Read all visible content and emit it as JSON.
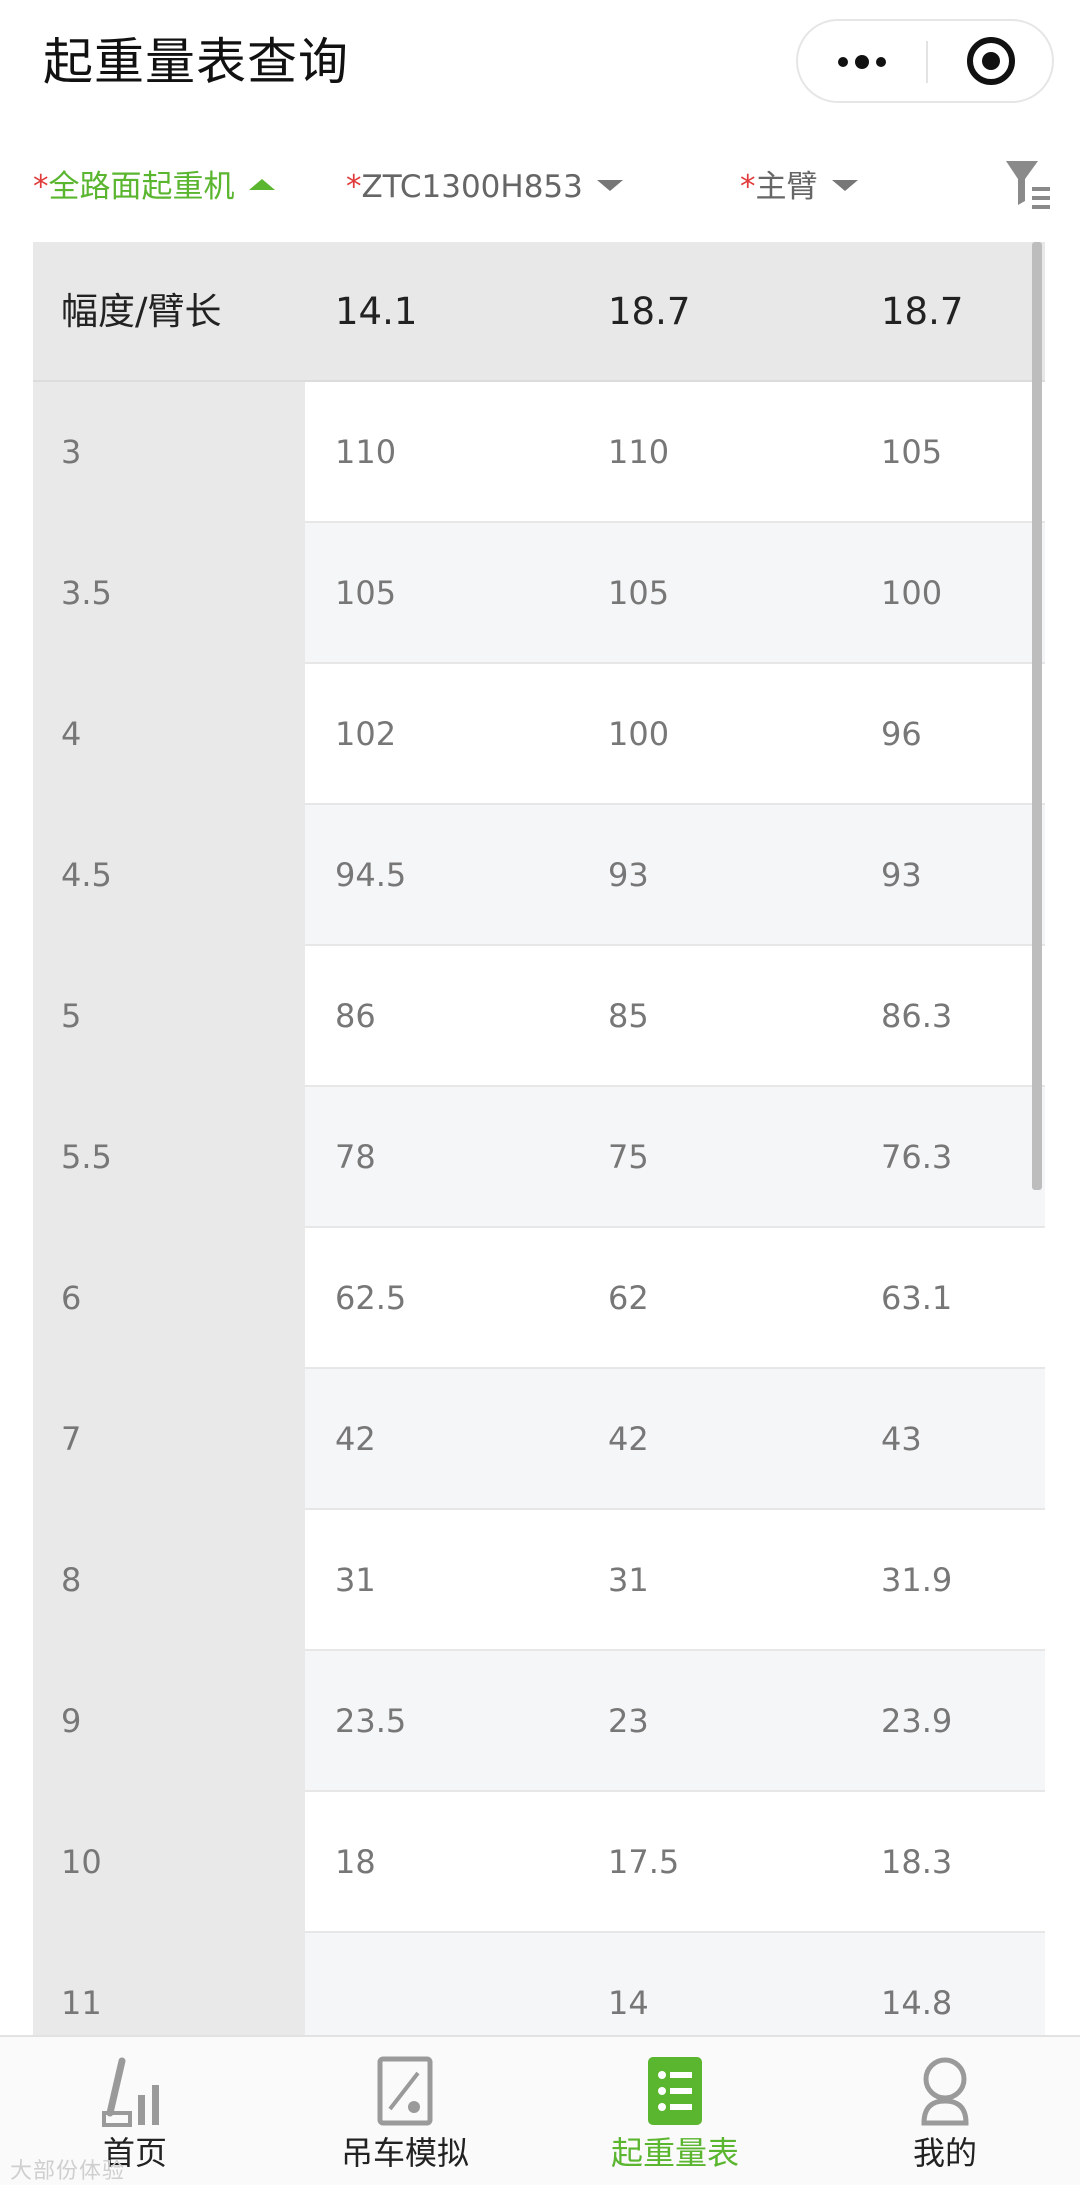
{
  "header": {
    "title": "起重量表查询"
  },
  "filters": [
    {
      "required_mark": "*",
      "label": "全路面起重机",
      "state": "expanded"
    },
    {
      "required_mark": "*",
      "label": "ZTC1300H853",
      "state": "collapsed"
    },
    {
      "required_mark": "*",
      "label": "主臂",
      "state": "collapsed"
    }
  ],
  "table": {
    "headers": [
      "幅度/臂长",
      "14.1",
      "18.7",
      "18.7"
    ],
    "rows": [
      [
        "3",
        "110",
        "110",
        "105"
      ],
      [
        "3.5",
        "105",
        "105",
        "100"
      ],
      [
        "4",
        "102",
        "100",
        "96"
      ],
      [
        "4.5",
        "94.5",
        "93",
        "93"
      ],
      [
        "5",
        "86",
        "85",
        "86.3"
      ],
      [
        "5.5",
        "78",
        "75",
        "76.3"
      ],
      [
        "6",
        "62.5",
        "62",
        "63.1"
      ],
      [
        "7",
        "42",
        "42",
        "43"
      ],
      [
        "8",
        "31",
        "31",
        "31.9"
      ],
      [
        "9",
        "23.5",
        "23",
        "23.9"
      ],
      [
        "10",
        "18",
        "17.5",
        "18.3"
      ],
      [
        "11",
        "",
        "14",
        "14.8"
      ]
    ]
  },
  "tabbar": {
    "tabs": [
      {
        "label": "首页",
        "icon": "crane-home-icon",
        "active": false
      },
      {
        "label": "吊车模拟",
        "icon": "simulation-icon",
        "active": false
      },
      {
        "label": "起重量表",
        "icon": "load-chart-icon",
        "active": true
      },
      {
        "label": "我的",
        "icon": "profile-icon",
        "active": false
      }
    ]
  },
  "colors": {
    "accent": "#5ab52f",
    "required": "#e03a3a",
    "first_column_bg": "#e9e9e9",
    "header_bg": "#e8e8e8"
  },
  "watermark": "大部份体验"
}
